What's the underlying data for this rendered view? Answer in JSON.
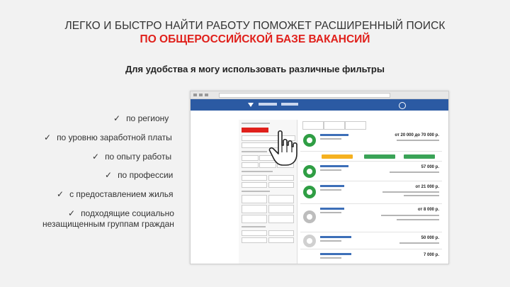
{
  "heading": {
    "line1": "ЛЕГКО И БЫСТРО НАЙТИ РАБОТУ ПОМОЖЕТ РАСШИРЕННЫЙ ПОИСК",
    "line2": "ПО ОБЩЕРОССИЙСКОЙ БАЗЕ ВАКАНСИЙ"
  },
  "subtitle": "Для удобства я могу использовать различные фильтры",
  "check_glyph": "✓",
  "filters": [
    {
      "label": "по региону"
    },
    {
      "label": "по уровню заработной платы"
    },
    {
      "label": "по опыту работы"
    },
    {
      "label": "по профессии"
    },
    {
      "label": "с предоставлением жилья"
    },
    {
      "label": "подходящие социально"
    },
    {
      "label": "незащищенным группам граждан"
    }
  ],
  "screenshot": {
    "salaries": [
      "от 20 000 до 70 000 р.",
      "57 000 р.",
      "от 21 000 р.",
      "от 8 000 р.",
      "50 000 р.",
      "7 000 р."
    ],
    "colors": {
      "nav": "#2b5aa3",
      "accent": "#e0201b",
      "logo": "#2f9e44"
    }
  }
}
